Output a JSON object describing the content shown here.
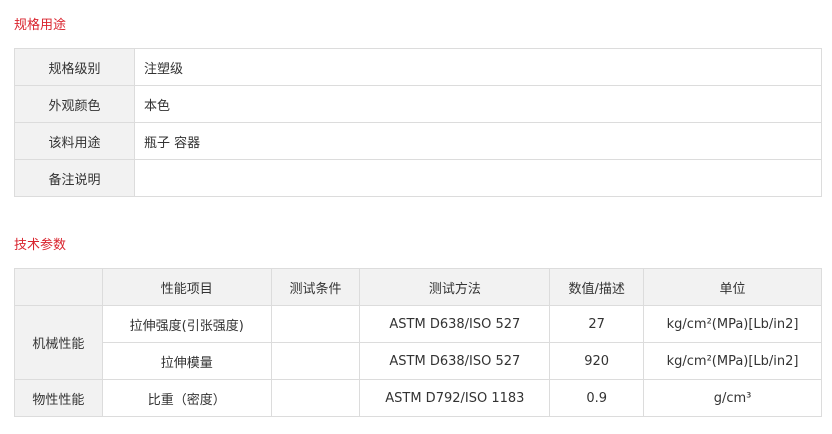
{
  "spec_section": {
    "title": "规格用途",
    "rows": [
      {
        "label": "规格级别",
        "value": "注塑级"
      },
      {
        "label": "外观颜色",
        "value": "本色"
      },
      {
        "label": "该料用途",
        "value": "瓶子 容器"
      },
      {
        "label": "备注说明",
        "value": ""
      }
    ]
  },
  "tech_section": {
    "title": "技术参数",
    "headers": [
      "",
      "性能项目",
      "测试条件",
      "测试方法",
      "数值/描述",
      "单位"
    ],
    "groups": [
      {
        "category": "机械性能",
        "rows": [
          {
            "item": "拉伸强度(引张强度)",
            "condition": "",
            "method": "ASTM D638/ISO 527",
            "value": "27",
            "unit": "kg/cm²(MPa)[Lb/in2]"
          },
          {
            "item": "拉伸模量",
            "condition": "",
            "method": "ASTM D638/ISO 527",
            "value": "920",
            "unit": "kg/cm²(MPa)[Lb/in2]"
          }
        ]
      },
      {
        "category": "物性性能",
        "rows": [
          {
            "item": "比重（密度）",
            "condition": "",
            "method": "ASTM D792/ISO 1183",
            "value": "0.9",
            "unit": "g/cm³"
          }
        ]
      }
    ]
  }
}
